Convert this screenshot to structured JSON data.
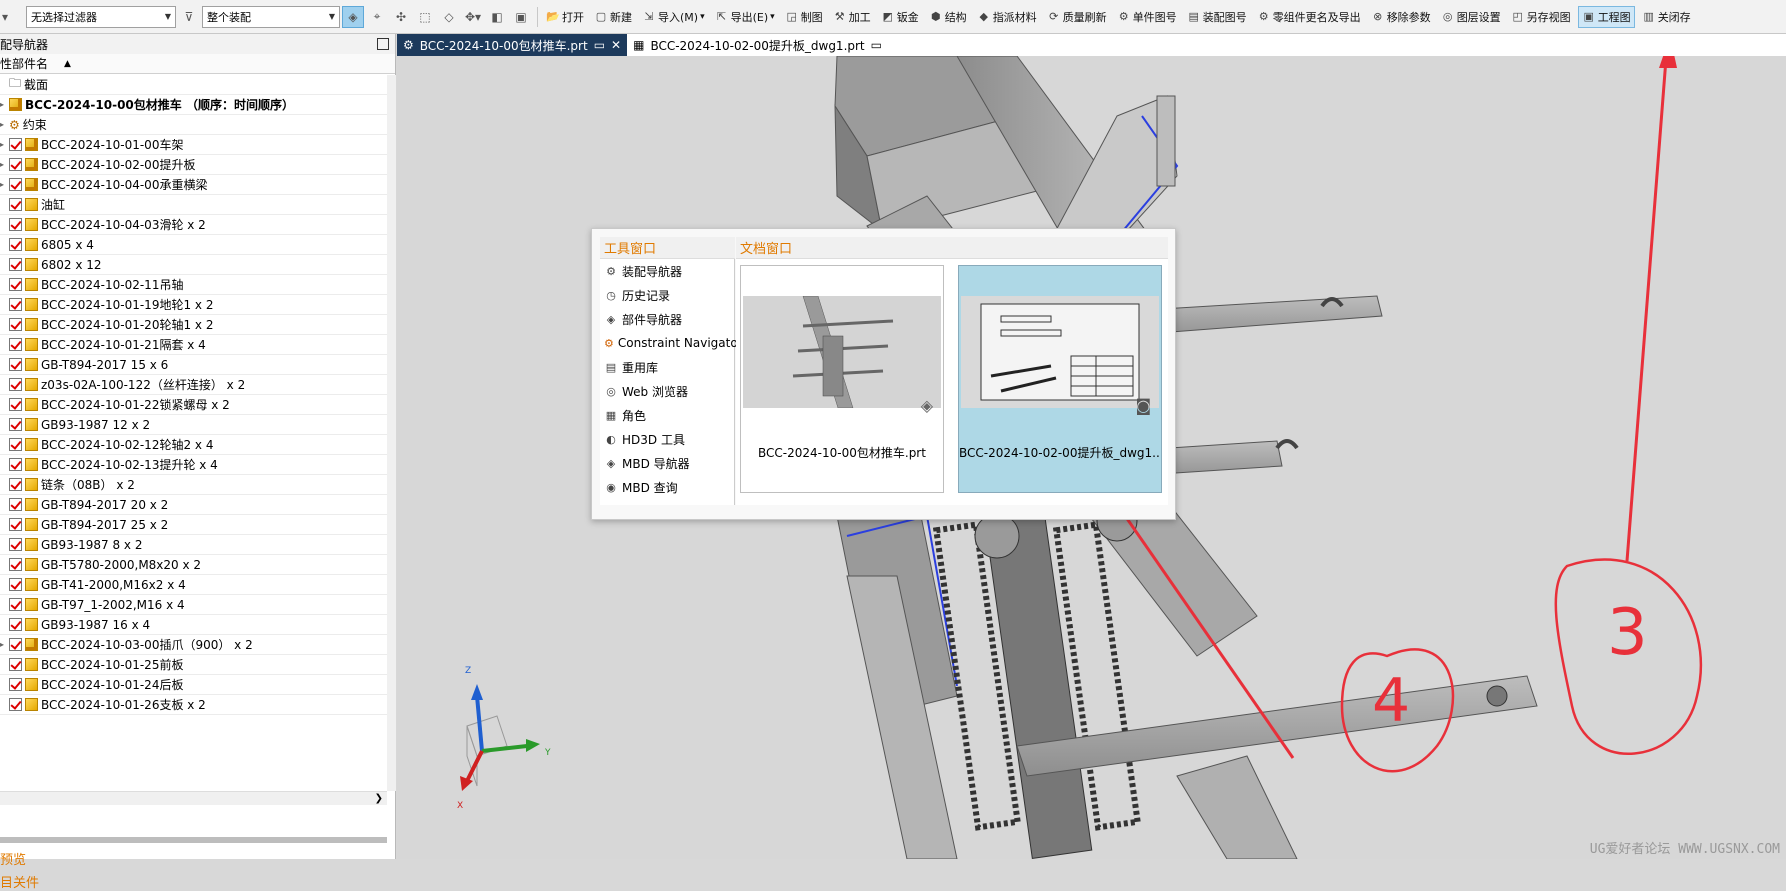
{
  "toolbar": {
    "filter_value": "无选择过滤器",
    "scope_value": "整个装配",
    "buttons": [
      {
        "label": "打开",
        "icon": "open-folder-icon"
      },
      {
        "label": "新建",
        "icon": "new-file-icon"
      },
      {
        "label": "导入(M)",
        "icon": "import-icon"
      },
      {
        "label": "导出(E)",
        "icon": "export-icon"
      },
      {
        "label": "制图",
        "icon": "drawing-icon"
      },
      {
        "label": "加工",
        "icon": "machining-icon"
      },
      {
        "label": "钣金",
        "icon": "sheet-metal-icon"
      },
      {
        "label": "结构",
        "icon": "structure-icon"
      },
      {
        "label": "指派材料",
        "icon": "assign-material-icon"
      },
      {
        "label": "质量刷新",
        "icon": "mass-refresh-icon"
      },
      {
        "label": "单件图号",
        "icon": "part-number-icon"
      },
      {
        "label": "装配图号",
        "icon": "assembly-number-icon"
      },
      {
        "label": "零组件更名及导出",
        "icon": "rename-export-icon"
      },
      {
        "label": "移除参数",
        "icon": "remove-params-icon"
      },
      {
        "label": "图层设置",
        "icon": "layer-settings-icon"
      },
      {
        "label": "另存视图",
        "icon": "save-view-icon"
      },
      {
        "label": "工程图",
        "icon": "engineering-drawing-icon"
      },
      {
        "label": "关闭存",
        "icon": "close-save-icon"
      }
    ]
  },
  "navigator": {
    "title": "配导航器",
    "column_header": "性部件名",
    "rows": [
      {
        "label": "截面",
        "type": "folder",
        "checked": false
      },
      {
        "label": "BCC-2024-10-00包材推车 （顺序：时间顺序）",
        "type": "asm",
        "checked": false,
        "bold": true
      },
      {
        "label": "约束",
        "type": "constraint",
        "checked": false
      },
      {
        "label": "BCC-2024-10-01-00车架",
        "type": "asm",
        "checked": true
      },
      {
        "label": "BCC-2024-10-02-00提升板",
        "type": "asm",
        "checked": true
      },
      {
        "label": "BCC-2024-10-04-00承重横梁",
        "type": "asm",
        "checked": true
      },
      {
        "label": "油缸",
        "type": "part",
        "checked": true
      },
      {
        "label": "BCC-2024-10-04-03滑轮 x 2",
        "type": "part",
        "checked": true
      },
      {
        "label": "6805 x 4",
        "type": "part",
        "checked": true
      },
      {
        "label": "6802 x 12",
        "type": "part",
        "checked": true
      },
      {
        "label": "BCC-2024-10-02-11吊轴",
        "type": "part",
        "checked": true
      },
      {
        "label": "BCC-2024-10-01-19地轮1 x 2",
        "type": "part",
        "checked": true
      },
      {
        "label": "BCC-2024-10-01-20轮轴1 x 2",
        "type": "part",
        "checked": true
      },
      {
        "label": "BCC-2024-10-01-21隔套 x 4",
        "type": "part",
        "checked": true
      },
      {
        "label": "GB-T894-2017 15 x 6",
        "type": "part",
        "checked": true
      },
      {
        "label": "z03s-02A-100-122（丝杆连接） x 2",
        "type": "part",
        "checked": true
      },
      {
        "label": "BCC-2024-10-01-22锁紧螺母 x 2",
        "type": "part",
        "checked": true
      },
      {
        "label": "GB93-1987 12 x 2",
        "type": "part",
        "checked": true
      },
      {
        "label": "BCC-2024-10-02-12轮轴2 x 4",
        "type": "part",
        "checked": true
      },
      {
        "label": "BCC-2024-10-02-13提升轮 x 4",
        "type": "part",
        "checked": true
      },
      {
        "label": "链条（08B） x 2",
        "type": "part",
        "checked": true
      },
      {
        "label": "GB-T894-2017 20 x 2",
        "type": "part",
        "checked": true
      },
      {
        "label": "GB-T894-2017 25 x 2",
        "type": "part",
        "checked": true
      },
      {
        "label": "GB93-1987 8 x 2",
        "type": "part",
        "checked": true
      },
      {
        "label": "GB-T5780-2000,M8x20 x 2",
        "type": "part",
        "checked": true
      },
      {
        "label": "GB-T41-2000,M16x2 x 4",
        "type": "part",
        "checked": true
      },
      {
        "label": "GB-T97_1-2002,M16 x 4",
        "type": "part",
        "checked": true
      },
      {
        "label": "GB93-1987 16 x 4",
        "type": "part",
        "checked": true
      },
      {
        "label": "BCC-2024-10-03-00插爪（900） x 2",
        "type": "asm",
        "checked": true
      },
      {
        "label": "BCC-2024-10-01-25前板",
        "type": "part",
        "checked": true
      },
      {
        "label": "BCC-2024-10-01-24后板",
        "type": "part",
        "checked": true
      },
      {
        "label": "BCC-2024-10-01-26支板 x 2",
        "type": "part",
        "checked": true
      }
    ],
    "bottom_links": [
      "预览",
      "目关件"
    ]
  },
  "tabs": [
    {
      "label": "BCC-2024-10-00包材推车.prt",
      "active": true
    },
    {
      "label": "BCC-2024-10-02-00提升板_dwg1.prt",
      "active": false
    }
  ],
  "switcher": {
    "tool_header": "工具窗口",
    "doc_header": "文档窗口",
    "tools": [
      {
        "label": "装配导航器",
        "icon": "assembly-navigator-icon"
      },
      {
        "label": "历史记录",
        "icon": "history-clock-icon"
      },
      {
        "label": "部件导航器",
        "icon": "part-navigator-icon"
      },
      {
        "label": "Constraint Navigator",
        "icon": "constraint-navigator-icon"
      },
      {
        "label": "重用库",
        "icon": "reuse-library-icon"
      },
      {
        "label": "Web 浏览器",
        "icon": "web-browser-icon"
      },
      {
        "label": "角色",
        "icon": "roles-icon"
      },
      {
        "label": "HD3D 工具",
        "icon": "hd3d-tools-icon"
      },
      {
        "label": "MBD 导航器",
        "icon": "mbd-navigator-icon"
      },
      {
        "label": "MBD 查询",
        "icon": "mbd-query-icon"
      }
    ],
    "docs": [
      {
        "label": "BCC-2024-10-00包材推车.prt",
        "selected": false
      },
      {
        "label": "BCC-2024-10-02-00提升板_dwg1....",
        "selected": true
      }
    ]
  },
  "annotations": {
    "mark_3": "3",
    "mark_4": "4",
    "color": "#e8303a"
  },
  "triad": {
    "x": "Y",
    "z": "Z",
    "neg": "X"
  },
  "watermark": "UG爱好者论坛 WWW.UGSNX.COM"
}
